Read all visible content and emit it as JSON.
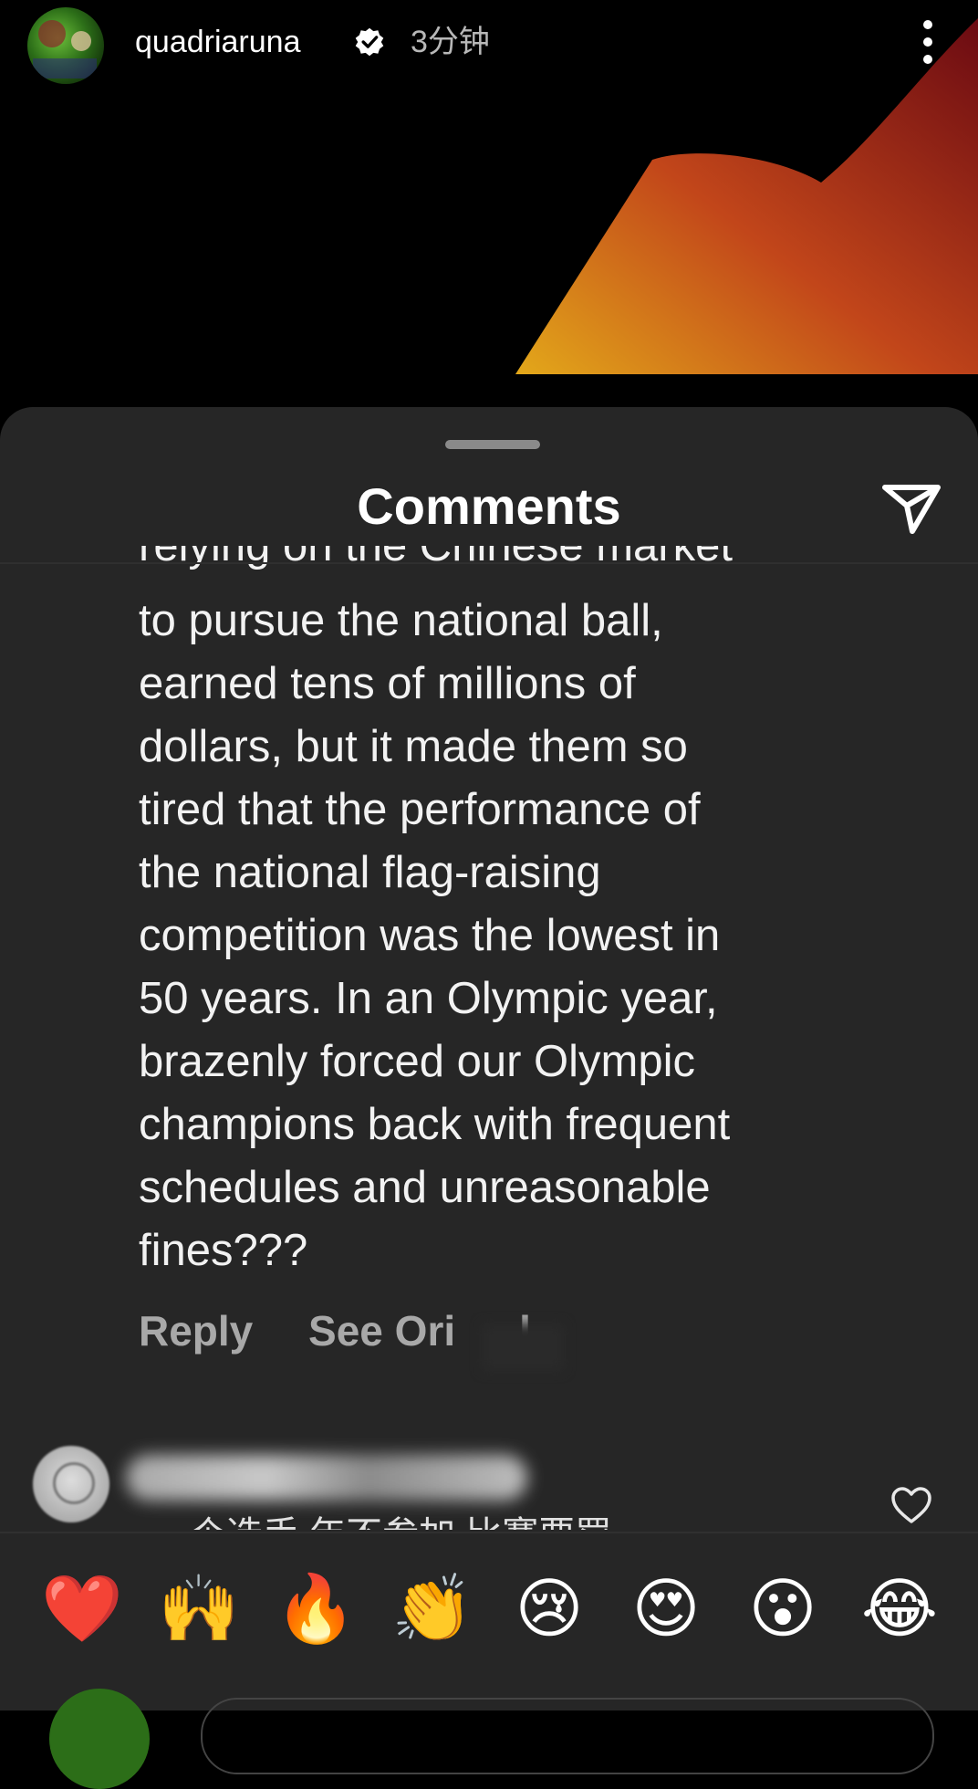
{
  "story": {
    "username": "quadriaruna",
    "time_ago": "3分钟",
    "accent_colors": [
      "#b01818",
      "#e3a81a"
    ]
  },
  "comments_sheet": {
    "title": "Comments",
    "top_cut_line": "relying on the Chinese market",
    "comment_text": "to pursue the national ball,\nearned tens of millions of\ndollars, but it made them so\ntired that the performance of\nthe national flag-raising\ncompetition was the lowest in\n50 years. In an Olympic year,\nbrazenly forced our Olympic\nchampions back with frequent\nschedules and unreasonable\nfines???",
    "reply_label": "Reply",
    "see_original_label": "See Ori",
    "see_original_tail": "l",
    "next_comment_partial": "个选手 年不参加 比赛要罚"
  },
  "emoji_bar": {
    "emojis": [
      "❤️",
      "🙌",
      "🔥",
      "👏",
      "😢",
      "😍",
      "😮",
      "😂"
    ]
  }
}
